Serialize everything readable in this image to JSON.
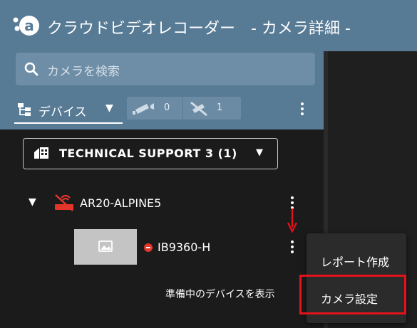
{
  "header": {
    "title": "クラウドビデオレコーダー　- カメラ詳細 -"
  },
  "search": {
    "placeholder": "カメラを検索"
  },
  "device_selector": {
    "label": "デバイス",
    "online_count": "0",
    "offline_count": "1"
  },
  "tenant": {
    "label": "TECHNICAL SUPPORT 3 (1)"
  },
  "tree": {
    "router_label": "AR20-ALPINE5",
    "camera_label": "IB9360-H",
    "show_preparing": "準備中のデバイスを表示"
  },
  "context_menu": {
    "items": [
      {
        "label": "レポート作成"
      },
      {
        "label": "カメラ設定"
      }
    ]
  },
  "colors": {
    "header_bg": "#577a95",
    "highlight": "#e3121b",
    "status_error": "#e5352b",
    "arrow": "#e3121b"
  }
}
